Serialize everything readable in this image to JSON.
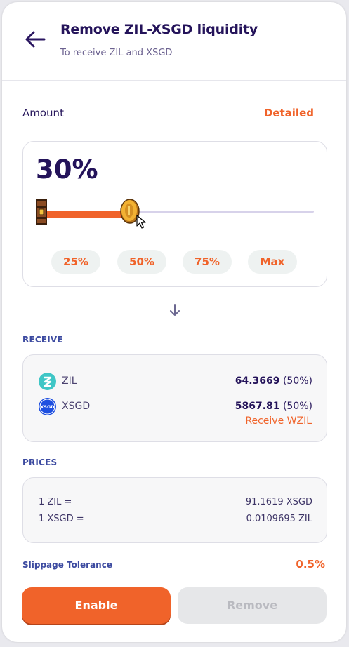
{
  "header": {
    "title": "Remove ZIL-XSGD liquidity",
    "subtitle": "To receive ZIL and XSGD"
  },
  "amount": {
    "label": "Amount",
    "detailed_label": "Detailed",
    "percent_text": "30%",
    "percent_value": 30,
    "presets": [
      "25%",
      "50%",
      "75%",
      "Max"
    ]
  },
  "receive": {
    "label": "RECEIVE",
    "tokens": [
      {
        "symbol": "ZIL",
        "amount": "64.3669",
        "share": "(50%)",
        "icon": "zil-icon"
      },
      {
        "symbol": "XSGD",
        "amount": "5867.81",
        "share": "(50%)",
        "icon": "xsgd-icon",
        "icon_text": "XSGD"
      }
    ],
    "wzil_link": "Receive WZIL"
  },
  "prices": {
    "label": "PRICES",
    "rows": [
      {
        "lhs": "1 ZIL =",
        "rhs": "91.1619 XSGD"
      },
      {
        "lhs": "1 XSGD =",
        "rhs": "0.0109695 ZIL"
      }
    ]
  },
  "slippage": {
    "label": "Slippage Tolerance",
    "value": "0.5%"
  },
  "buttons": {
    "enable": "Enable",
    "remove": "Remove"
  },
  "colors": {
    "accent": "#f0632a",
    "primary_text": "#24135a",
    "section_label": "#3c4aa0",
    "zil_teal": "#3fc6c6",
    "xsgd_blue": "#1e4fe0"
  }
}
